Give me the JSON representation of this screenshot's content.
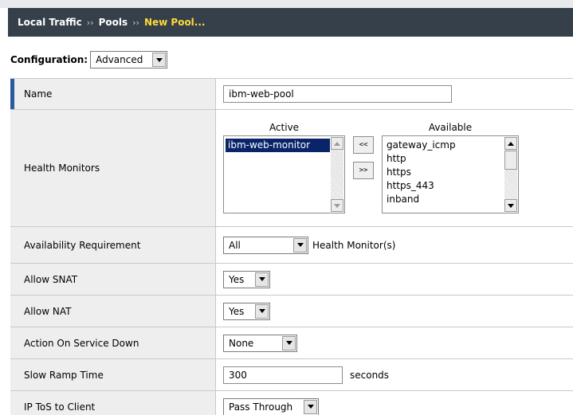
{
  "breadcrumb": {
    "items": [
      "Local Traffic",
      "Pools"
    ],
    "separator": "››",
    "current": "New Pool..."
  },
  "configuration": {
    "label": "Configuration:",
    "selected": "Advanced"
  },
  "form": {
    "name": {
      "label": "Name",
      "value": "ibm-web-pool"
    },
    "health_monitors": {
      "label": "Health Monitors",
      "active_heading": "Active",
      "available_heading": "Available",
      "active": [
        "ibm-web-monitor"
      ],
      "available": [
        "gateway_icmp",
        "http",
        "https",
        "https_443",
        "inband"
      ],
      "move_left_label": "<<",
      "move_right_label": ">>"
    },
    "availability": {
      "label": "Availability Requirement",
      "selected": "All",
      "suffix": "Health Monitor(s)"
    },
    "allow_snat": {
      "label": "Allow SNAT",
      "selected": "Yes"
    },
    "allow_nat": {
      "label": "Allow NAT",
      "selected": "Yes"
    },
    "action_on_service_down": {
      "label": "Action On Service Down",
      "selected": "None"
    },
    "slow_ramp_time": {
      "label": "Slow Ramp Time",
      "value": "300",
      "unit": "seconds"
    },
    "ip_tos_to_client": {
      "label": "IP ToS to Client",
      "selected": "Pass Through"
    }
  },
  "colors": {
    "title_bg": "#35404b",
    "title_current": "#ffd93b",
    "row_label_bg": "#eeeeee",
    "active_marker": "#2b5b9f",
    "selected_item_bg": "#0a246a"
  }
}
